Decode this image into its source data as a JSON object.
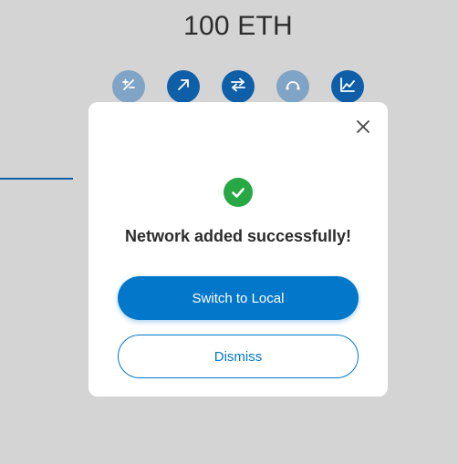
{
  "wallet": {
    "balance": "100 ETH"
  },
  "actions": [
    {
      "name": "buy-sell",
      "icon": "plus-minus-icon",
      "enabled": false
    },
    {
      "name": "send",
      "icon": "arrow-up-right-icon",
      "enabled": true
    },
    {
      "name": "swap",
      "icon": "swap-arrows-icon",
      "enabled": true
    },
    {
      "name": "bridge",
      "icon": "bridge-icon",
      "enabled": false
    },
    {
      "name": "portfolio",
      "icon": "chart-line-icon",
      "enabled": true
    }
  ],
  "modal": {
    "title": "Network added successfully!",
    "primary_button": "Switch to Local",
    "secondary_button": "Dismiss",
    "close_icon": "close-icon",
    "success_icon": "check-circle-icon"
  },
  "colors": {
    "background": "#d4d4d4",
    "brand_blue": "#0377ca",
    "dark_blue": "#0f5fa8",
    "disabled_blue": "#7fa4c6",
    "success_green": "#28a745",
    "text": "#2c2c2c"
  }
}
